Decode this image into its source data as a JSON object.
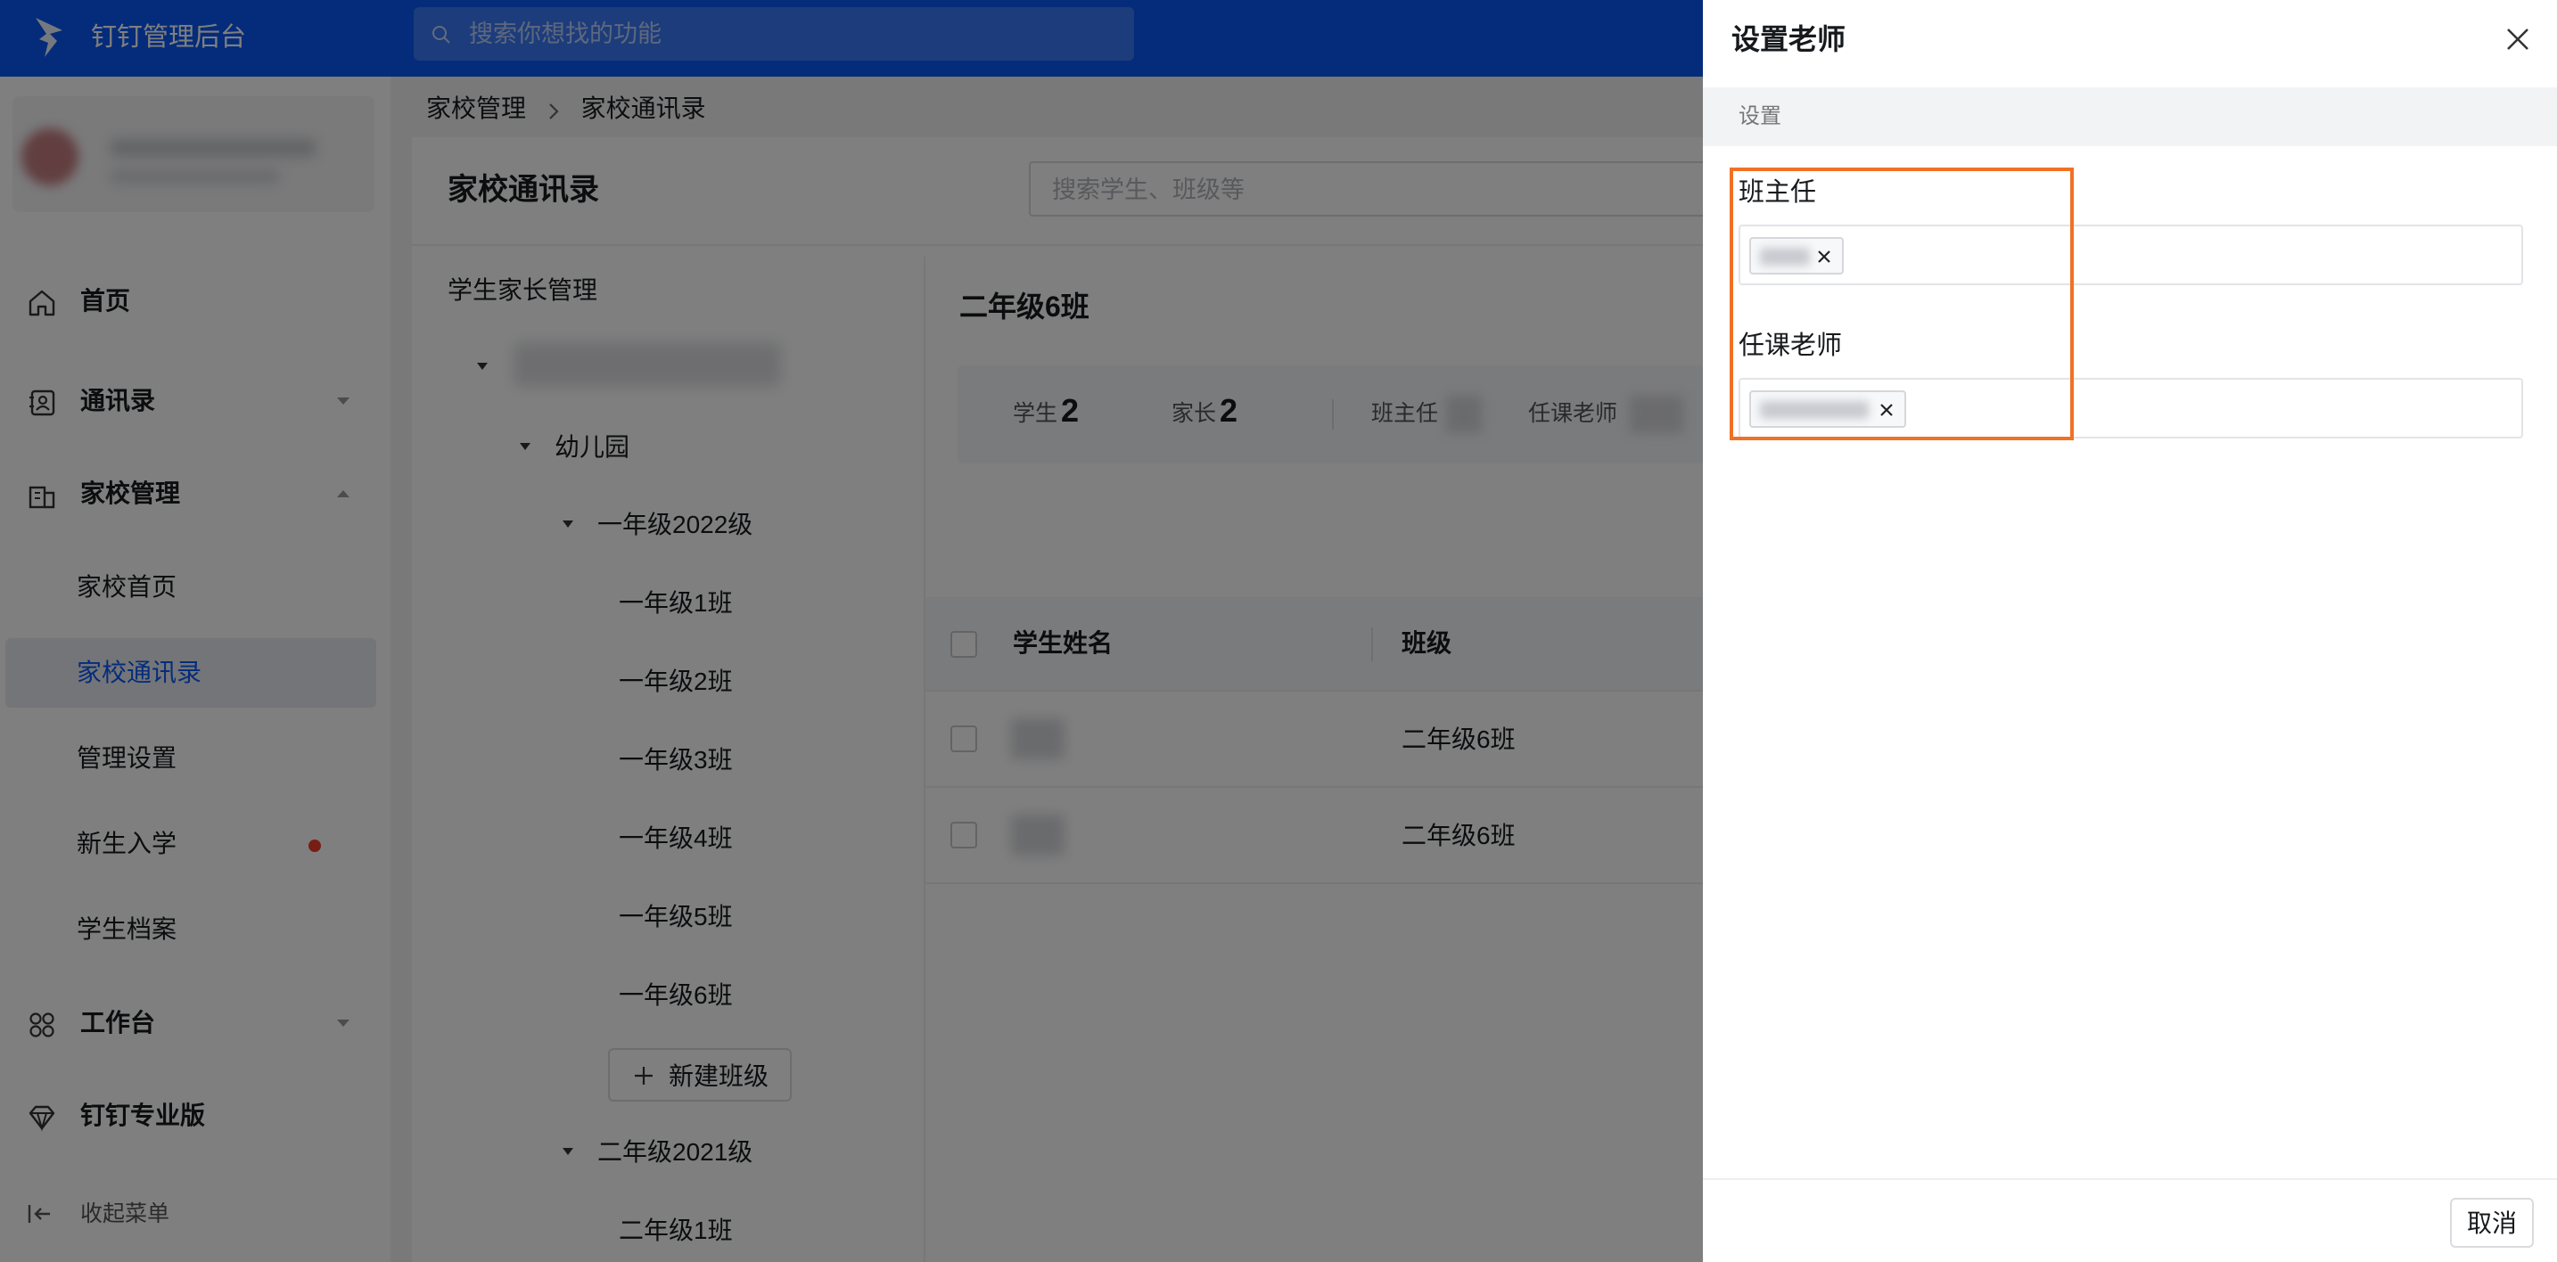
{
  "app": {
    "brand": "钉钉管理后台",
    "search_placeholder": "搜索你想找的功能"
  },
  "sidebar": {
    "nav": [
      {
        "label": "首页",
        "icon": "home-icon"
      },
      {
        "label": "通讯录",
        "icon": "contacts-icon"
      },
      {
        "label": "家校管理",
        "icon": "school-icon"
      },
      {
        "label": "工作台",
        "icon": "workbench-icon"
      },
      {
        "label": "钉钉专业版",
        "icon": "diamond-icon"
      }
    ],
    "sub_items": [
      "家校首页",
      "家校通讯录",
      "管理设置",
      "新生入学",
      "学生档案"
    ],
    "active_sub": "家校通讯录",
    "collapse_label": "收起菜单"
  },
  "breadcrumb": [
    "家校管理",
    "家校通讯录"
  ],
  "main": {
    "title": "家校通讯录",
    "search_placeholder": "搜索学生、班级等",
    "tree_title": "学生家长管理",
    "tree": {
      "kindergarten": "幼儿园",
      "grade1": "一年级2022级",
      "grade1_classes": [
        "一年级1班",
        "一年级2班",
        "一年级3班",
        "一年级4班",
        "一年级5班",
        "一年级6班"
      ],
      "new_class": "新建班级",
      "grade2": "二年级2021级",
      "grade2_classes": [
        "二年级1班"
      ]
    },
    "class_title": "二年级6班",
    "stats": {
      "students_label": "学生",
      "students": "2",
      "parents_label": "家长",
      "parents": "2",
      "head_teacher_label": "班主任",
      "teachers_label": "任课老师"
    },
    "table": {
      "headers": [
        "学生姓名",
        "班级"
      ],
      "rows": [
        {
          "class": "二年级6班"
        },
        {
          "class": "二年级6班"
        }
      ]
    }
  },
  "drawer": {
    "title": "设置老师",
    "section": "设置",
    "head_teacher_label": "班主任",
    "teachers_label": "任课老师",
    "cancel": "取消"
  },
  "colors": {
    "brand": "#0a58f6",
    "highlight": "#f07126",
    "badge": "#f03a2b"
  }
}
